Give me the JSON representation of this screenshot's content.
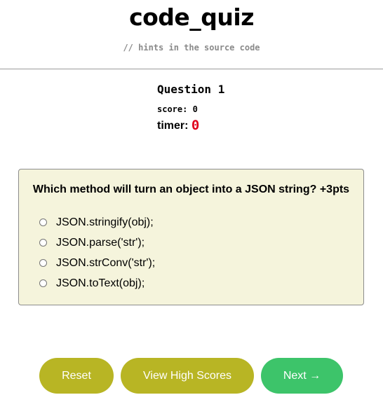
{
  "header": {
    "title": "code_quiz",
    "subtitle": "// hints in the source code"
  },
  "status": {
    "question_label": "Question 1",
    "score_label": "score:",
    "score_value": "0",
    "timer_label": "timer:",
    "timer_value": "0"
  },
  "question": {
    "text": "Which method will turn an object into a JSON string? +3pts",
    "answers": [
      {
        "label": "JSON.stringify(obj);",
        "selected": false
      },
      {
        "label": "JSON.parse('str');",
        "selected": false
      },
      {
        "label": "JSON.strConv('str');",
        "selected": false
      },
      {
        "label": "JSON.toText(obj);",
        "selected": false
      }
    ]
  },
  "buttons": {
    "reset": "Reset",
    "high_scores": "View High Scores",
    "next": "Next →"
  },
  "colors": {
    "card_background": "#f5f4dc",
    "olive_button": "#b8b524",
    "green_button": "#3dc46a",
    "timer_red": "#e0001b",
    "subtitle_gray": "#8a8a8a"
  }
}
